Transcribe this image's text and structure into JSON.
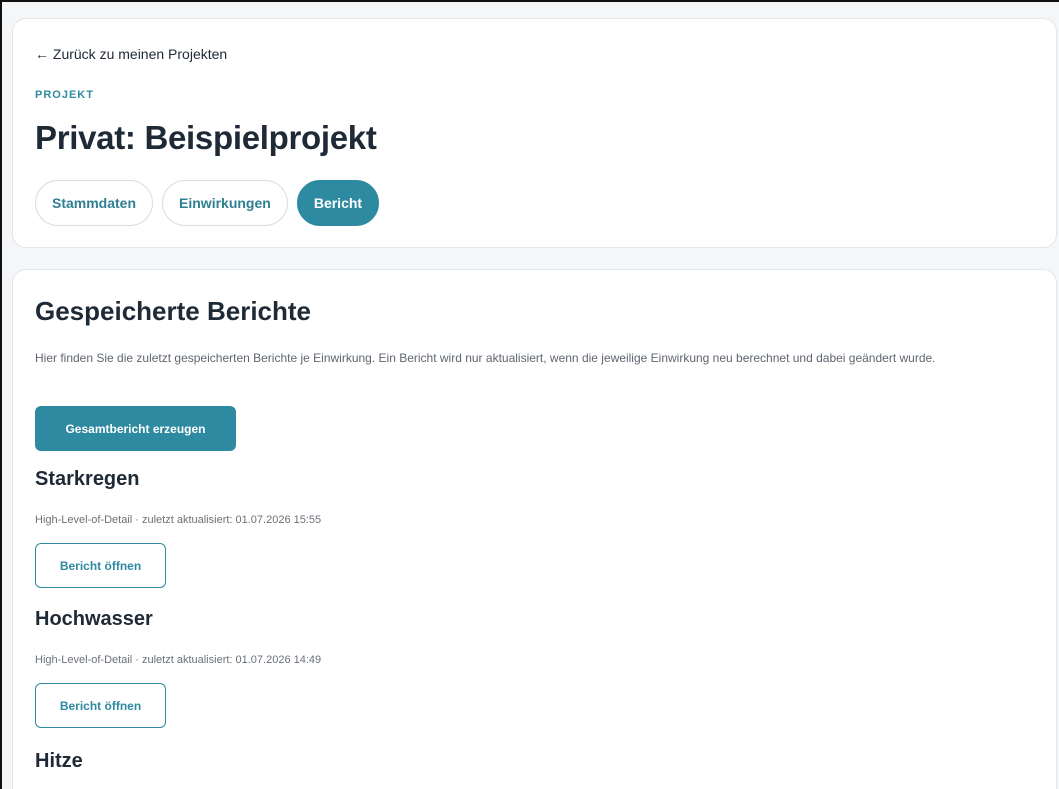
{
  "header": {
    "back_link": "← Zurück zu meinen Projekten",
    "eyebrow": "PROJEKT",
    "title": "Privat: Beispielprojekt",
    "tabs": [
      {
        "label": "Stammdaten",
        "active": false
      },
      {
        "label": "Einwirkungen",
        "active": false
      },
      {
        "label": "Bericht",
        "active": true
      }
    ]
  },
  "reports_section": {
    "title": "Gespeicherte Berichte",
    "description": "Hier finden Sie die zuletzt gespeicherten Berichte je Einwirkung. Ein Bericht wird nur aktualisiert, wenn die jeweilige Einwirkung neu berechnet und dabei geändert wurde.",
    "generate_button": "Gesamtbericht erzeugen",
    "reports": [
      {
        "title": "Starkregen",
        "meta": "High-Level-of-Detail · zuletzt aktualisiert: 01.07.2026 15:55",
        "open_button": "Bericht öffnen"
      },
      {
        "title": "Hochwasser",
        "meta": "High-Level-of-Detail · zuletzt aktualisiert: 01.07.2026 14:49",
        "open_button": "Bericht öffnen"
      },
      {
        "title": "Hitze"
      }
    ]
  },
  "colors": {
    "accent": "#2e8aa0",
    "text": "#1f2a37",
    "muted": "#6b7178",
    "background": "#f5f6f8"
  }
}
